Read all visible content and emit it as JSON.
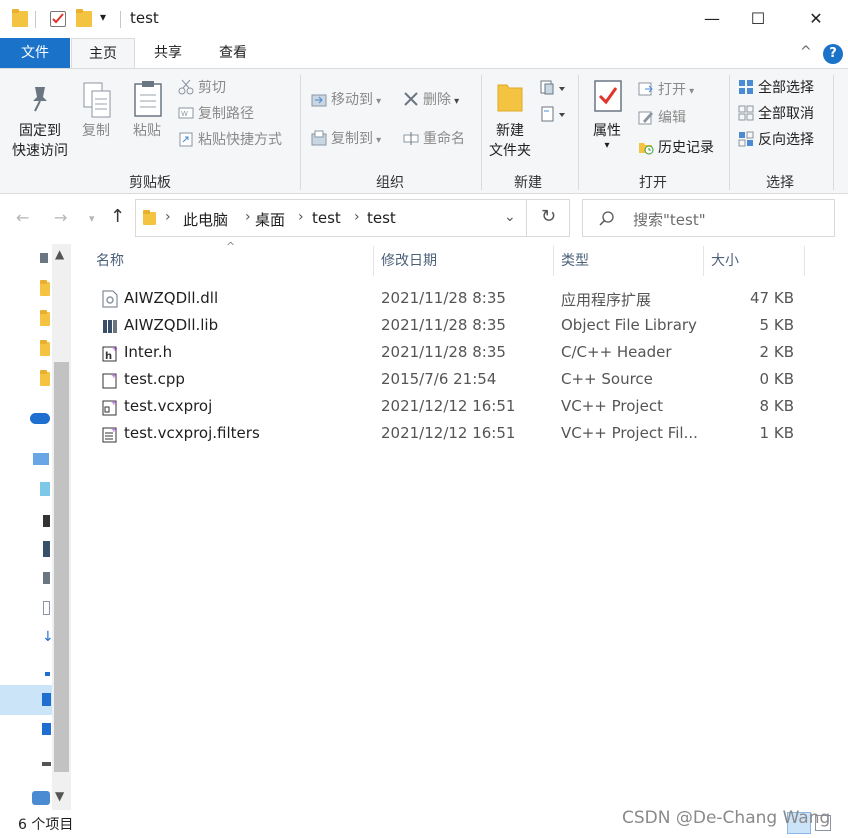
{
  "window": {
    "title": "test",
    "qa_dropdown": "▾",
    "min_glyph": "—",
    "max_glyph": "☐",
    "close_glyph": "✕"
  },
  "tabs": [
    {
      "label": "文件"
    },
    {
      "label": "主页"
    },
    {
      "label": "共享"
    },
    {
      "label": "查看"
    }
  ],
  "ribbon": {
    "help": "?",
    "collapse": "^",
    "clipboard": {
      "group": "剪贴板",
      "pin_line1": "固定到",
      "pin_line2": "快速访问",
      "copy": "复制",
      "paste": "粘贴",
      "cut": "剪切",
      "copy_path": "复制路径",
      "paste_shortcut": "粘贴快捷方式"
    },
    "organize": {
      "group": "组织",
      "move_to": "移动到",
      "copy_to": "复制到",
      "delete": "删除",
      "rename": "重命名"
    },
    "new": {
      "group": "新建",
      "new_folder_line1": "新建",
      "new_folder_line2": "文件夹"
    },
    "open": {
      "group": "打开",
      "properties": "属性",
      "open": "打开",
      "edit": "编辑",
      "history": "历史记录"
    },
    "select": {
      "group": "选择",
      "select_all": "全部选择",
      "select_none": "全部取消",
      "invert": "反向选择"
    }
  },
  "address": {
    "breadcrumbs": [
      "此电脑",
      "桌面",
      "test",
      "test"
    ],
    "search_placeholder": "搜索\"test\""
  },
  "columns": {
    "name": "名称",
    "date": "修改日期",
    "type": "类型",
    "size": "大小"
  },
  "files": [
    {
      "name": "AIWZQDll.dll",
      "date": "2021/11/28 8:35",
      "type": "应用程序扩展",
      "size": "47 KB"
    },
    {
      "name": "AIWZQDll.lib",
      "date": "2021/11/28 8:35",
      "type": "Object File Library",
      "size": "5 KB"
    },
    {
      "name": "Inter.h",
      "date": "2021/11/28 8:35",
      "type": "C/C++ Header",
      "size": "2 KB"
    },
    {
      "name": "test.cpp",
      "date": "2015/7/6 21:54",
      "type": "C++ Source",
      "size": "0 KB"
    },
    {
      "name": "test.vcxproj",
      "date": "2021/12/12 16:51",
      "type": "VC++ Project",
      "size": "8 KB"
    },
    {
      "name": "test.vcxproj.filters",
      "date": "2021/12/12 16:51",
      "type": "VC++ Project Fil...",
      "size": "1 KB"
    }
  ],
  "status": {
    "count": "6 个项目"
  },
  "watermark": "CSDN @De-Chang Wang",
  "colors": {
    "accent": "#1a73c9",
    "folder": "#f5c342"
  }
}
